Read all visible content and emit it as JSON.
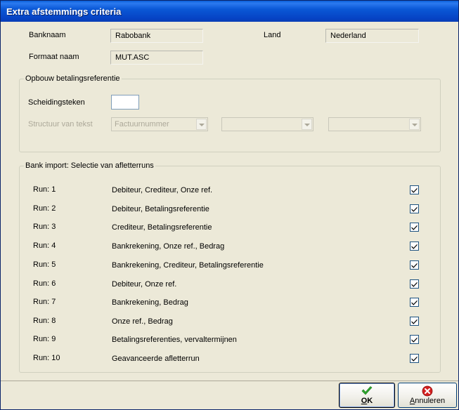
{
  "window": {
    "title": "Extra afstemmings criteria"
  },
  "header": {
    "banknaam_label": "Banknaam",
    "banknaam_value": "Rabobank",
    "land_label": "Land",
    "land_value": "Nederland",
    "formaat_label": "Formaat naam",
    "formaat_value": "MUT.ASC"
  },
  "opbouw": {
    "title": "Opbouw betalingsreferentie",
    "scheidingsteken_label": "Scheidingsteken",
    "scheidingsteken_value": "",
    "structuur_label": "Structuur van tekst",
    "combo1_value": "Factuurnummer",
    "combo2_value": "",
    "combo3_value": ""
  },
  "bank_import": {
    "title": "Bank import: Selectie van afletterruns",
    "runs": [
      {
        "label": "Run: 1",
        "description": "Debiteur, Crediteur, Onze ref.",
        "checked": true
      },
      {
        "label": "Run: 2",
        "description": "Debiteur, Betalingsreferentie",
        "checked": true
      },
      {
        "label": "Run: 3",
        "description": "Crediteur, Betalingsreferentie",
        "checked": true
      },
      {
        "label": "Run: 4",
        "description": "Bankrekening, Onze ref., Bedrag",
        "checked": true
      },
      {
        "label": "Run: 5",
        "description": "Bankrekening, Crediteur, Betalingsreferentie",
        "checked": true
      },
      {
        "label": "Run: 6",
        "description": "Debiteur, Onze ref.",
        "checked": true
      },
      {
        "label": "Run: 7",
        "description": "Bankrekening, Bedrag",
        "checked": true
      },
      {
        "label": "Run: 8",
        "description": "Onze ref., Bedrag",
        "checked": true
      },
      {
        "label": "Run: 9",
        "description": "Betalingsreferenties, vervaltermijnen",
        "checked": true
      },
      {
        "label": "Run: 10",
        "description": "Geavanceerde afletterrun",
        "checked": true
      }
    ]
  },
  "buttons": {
    "ok_first": "O",
    "ok_rest": "K",
    "annuleren_first": "A",
    "annuleren_rest": "nnuleren"
  },
  "colors": {
    "ok_icon": "#2fa82f",
    "cancel_icon": "#d42020"
  }
}
